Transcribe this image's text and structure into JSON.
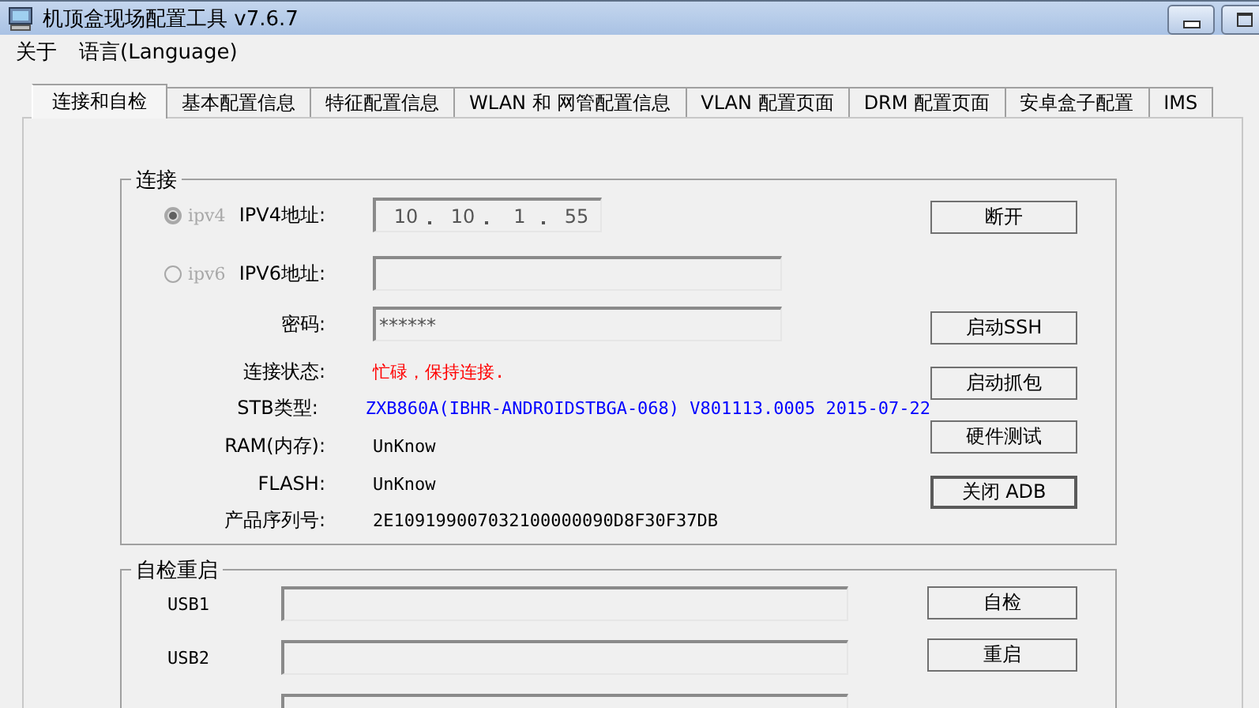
{
  "window": {
    "title": "机顶盒现场配置工具 v7.6.7"
  },
  "menu": [
    {
      "label": "关于"
    },
    {
      "label": "语言(Language)"
    }
  ],
  "tabs": [
    {
      "label": "连接和自检",
      "selected": true
    },
    {
      "label": "基本配置信息",
      "selected": false
    },
    {
      "label": "特征配置信息",
      "selected": false
    },
    {
      "label": "WLAN 和 网管配置信息",
      "selected": false
    },
    {
      "label": "VLAN 配置页面",
      "selected": false
    },
    {
      "label": "DRM 配置页面",
      "selected": false
    },
    {
      "label": "安卓盒子配置",
      "selected": false
    },
    {
      "label": "IMS",
      "selected": false
    }
  ],
  "connection": {
    "title": "连接",
    "rows": [
      {
        "kind": "ip",
        "option": {
          "label": "ipv4",
          "selected": true,
          "disabled": true
        },
        "label": "IPV4地址:",
        "octets": [
          "10",
          "10",
          "1",
          "55"
        ]
      },
      {
        "kind": "field",
        "option": {
          "label": "ipv6",
          "selected": false,
          "disabled": true
        },
        "label": "IPV6地址:"
      },
      {
        "kind": "field",
        "label": "密码:",
        "value": "******"
      },
      {
        "kind": "info",
        "label": "连接状态:",
        "value": "忙碌，保持连接.",
        "color": "#ff0000"
      },
      {
        "kind": "info",
        "label": "STB类型:",
        "value": "ZXB860A(IBHR-ANDROIDSTBGA-068) V801113.0005 2015-07-22",
        "color": "#0000ff"
      },
      {
        "kind": "info",
        "label": "RAM(内存):",
        "value": "UnKnow",
        "color": "#000000"
      },
      {
        "kind": "info",
        "label": "FLASH:",
        "value": "UnKnow",
        "color": "#000000"
      },
      {
        "kind": "info",
        "label": "产品序列号:",
        "value": "2E109199007032100000090D8F30F37DB",
        "color": "#000000"
      }
    ],
    "buttons": [
      {
        "label": "断开",
        "default": false
      },
      {
        "label": "启动SSH",
        "default": false
      },
      {
        "label": "启动抓包",
        "default": false
      },
      {
        "label": "硬件测试",
        "default": false
      },
      {
        "label": "关闭 ADB",
        "default": true
      }
    ]
  },
  "self_test": {
    "title": "自检重启",
    "rows": [
      {
        "kind": "field",
        "label": "USB1"
      },
      {
        "kind": "field",
        "label": "USB2"
      },
      {
        "kind": "field"
      }
    ],
    "buttons": [
      {
        "label": "自检",
        "default": false
      },
      {
        "label": "重启",
        "default": false
      }
    ]
  }
}
